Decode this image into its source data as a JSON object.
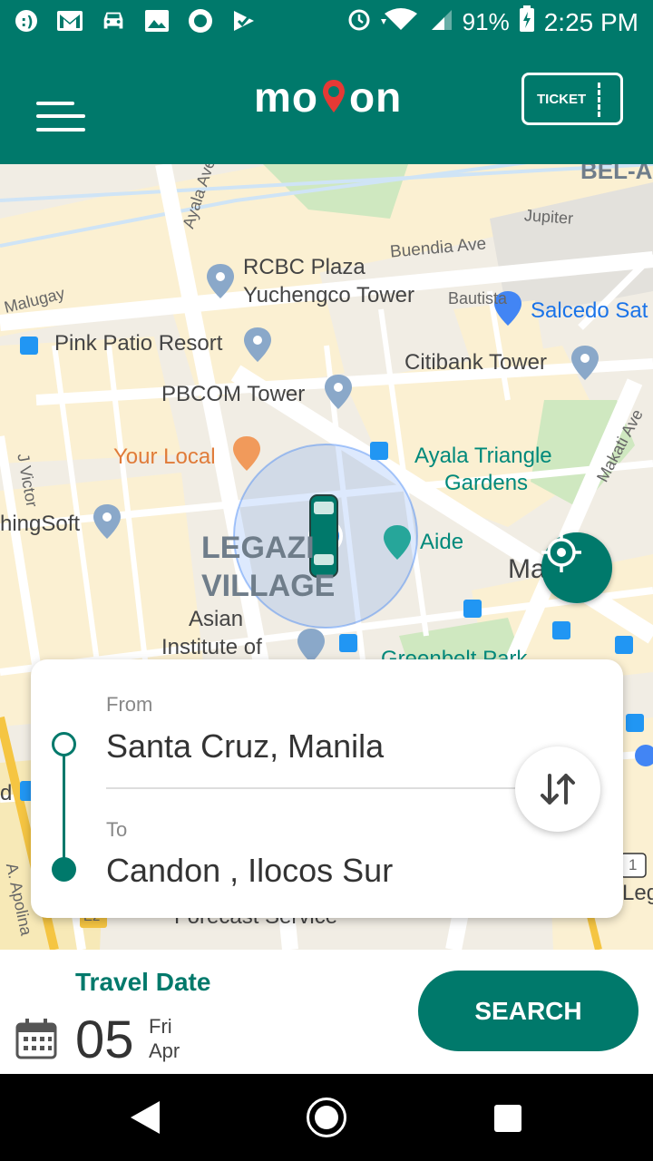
{
  "status_bar": {
    "battery": "91%",
    "time": "2:25 PM",
    "icons": [
      "chat-icon",
      "gmail-icon",
      "car-icon",
      "image-icon",
      "record-icon",
      "check-icon",
      "alarm-icon",
      "wifi-icon",
      "signal-icon",
      "battery-icon"
    ]
  },
  "app_bar": {
    "logo_left": "mo",
    "logo_right": "on",
    "ticket_label": "TICKET"
  },
  "map": {
    "labels": {
      "bel_air": "BEL-A",
      "jupiter": "Jupiter",
      "ayala_ave": "Ayala Ave",
      "buendia": "Buendia Ave",
      "rcbc_line1": "RCBC Plaza",
      "rcbc_line2": "Yuchengco Tower",
      "malugay": "Malugay",
      "bautista": "Bautista",
      "salcedo": "Salcedo Sat",
      "pink_patio": "Pink Patio Resort",
      "citibank": "Citibank Tower",
      "pbcom": "PBCOM Tower",
      "your_local": "Your Local",
      "ayala_triangle_1": "Ayala Triangle",
      "ayala_triangle_2": "Gardens",
      "j_victor": "J Victor",
      "ningsoft": "hingSoft",
      "legazpi_1": "LEGAZI",
      "legazpi_2": "VILLAGE",
      "aide": "Aide",
      "makati_ave": "Makati Ave",
      "ma": "Ma",
      "asian_1": "Asian",
      "asian_2": "Institute of",
      "greenbelt": "Greenbelt Park",
      "forecast": "Forecast Service",
      "a_apolinario": "A. Apolina",
      "d_left": "d",
      "leg_right": "Leg",
      "e2": "E2",
      "one": "1"
    }
  },
  "route": {
    "from_label": "From",
    "from_value": "Santa Cruz, Manila",
    "to_label": "To",
    "to_value": "Candon , Ilocos Sur"
  },
  "travel": {
    "label": "Travel Date",
    "day": "05",
    "weekday": "Fri",
    "month": "Apr",
    "search_label": "SEARCH"
  },
  "colors": {
    "primary": "#00796b",
    "accent_red": "#e53935"
  }
}
